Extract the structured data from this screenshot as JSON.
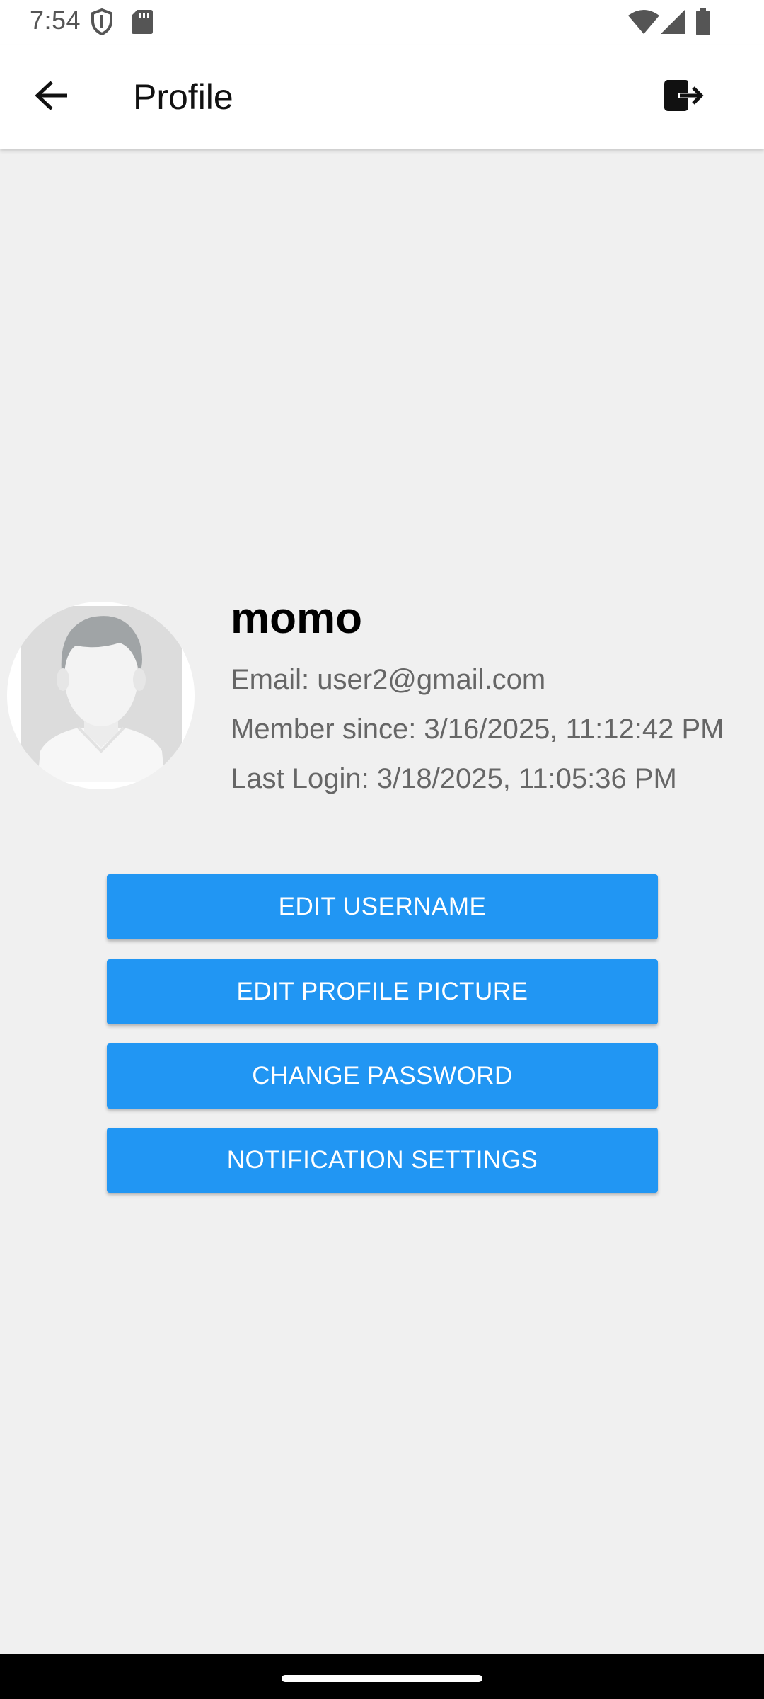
{
  "status_bar": {
    "time": "7:54",
    "icons": [
      "shield-icon",
      "sd-card-icon",
      "wifi-icon",
      "signal-icon",
      "battery-icon"
    ]
  },
  "app_bar": {
    "title": "Profile",
    "back_icon": "arrow-left-icon",
    "logout_icon": "logout-icon"
  },
  "profile": {
    "username": "momo",
    "email": "Email: user2@gmail.com",
    "member_since": "Member since: 3/16/2025, 11:12:42 PM",
    "last_login": "Last Login: 3/18/2025, 11:05:36 PM",
    "avatar_icon": "default-avatar-icon"
  },
  "actions": {
    "edit_username": "EDIT USERNAME",
    "edit_profile_picture": "EDIT PROFILE PICTURE",
    "change_password": "CHANGE PASSWORD",
    "notification_settings": "NOTIFICATION SETTINGS"
  },
  "colors": {
    "accent": "#2196f3",
    "background": "#f0f0f0",
    "app_bar": "#ffffff"
  }
}
